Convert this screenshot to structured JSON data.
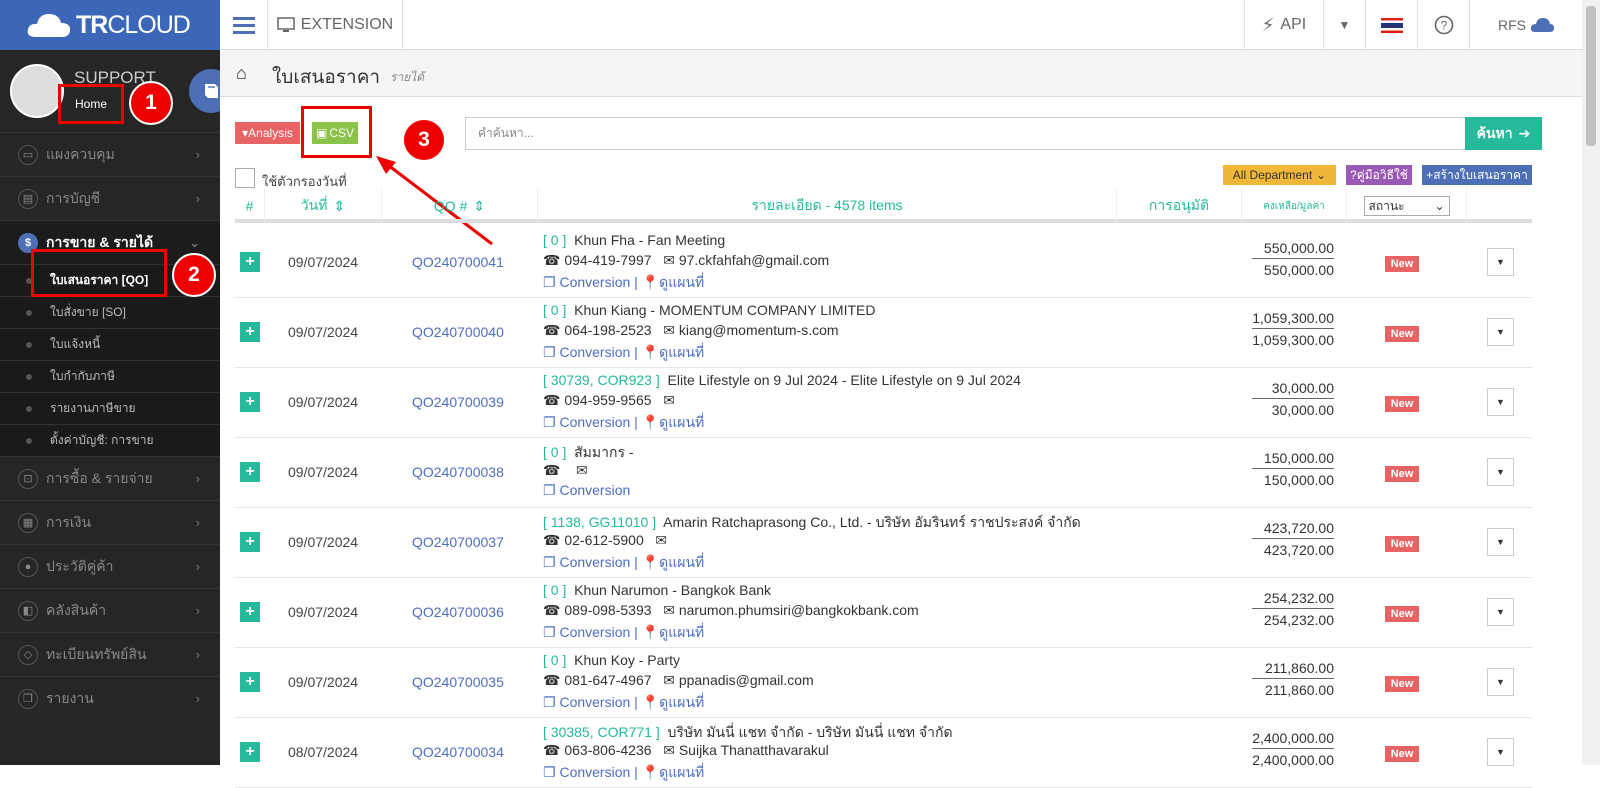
{
  "logo": {
    "bold": "TR",
    "rest": "CLOUD"
  },
  "topbar": {
    "extension": "EXTENSION",
    "api": "API",
    "user": "RFS"
  },
  "profile": {
    "name": "SUPPORT",
    "home": "Home",
    "sep": "| S"
  },
  "sidebar": {
    "items": [
      {
        "label": "แผงควบคุม",
        "icon": "monitor-icon"
      },
      {
        "label": "การบัญชี",
        "icon": "book-icon"
      },
      {
        "label": "การขาย & รายได้",
        "icon": "dollar-icon"
      },
      {
        "label": "การซื้อ & รายจ่าย",
        "icon": "cart-icon"
      },
      {
        "label": "การเงิน",
        "icon": "calendar-icon"
      },
      {
        "label": "ประวัติคู่ค้า",
        "icon": "users-icon"
      },
      {
        "label": "คลังสินค้า",
        "icon": "box-icon"
      },
      {
        "label": "ทะเบียนทรัพย์สิน",
        "icon": "diamond-icon"
      },
      {
        "label": "รายงาน",
        "icon": "copy-icon"
      }
    ],
    "subitems": [
      "ใบเสนอราคา [QO]",
      "ใบสั่งขาย [SO]",
      "ใบแจ้งหนี้",
      "ใบกำกับภาษี",
      "รายงานภาษีขาย",
      "ตั้งค่าบัญชี: การขาย"
    ]
  },
  "badges": [
    "1",
    "2",
    "3"
  ],
  "page": {
    "title": "ใบเสนอราคา",
    "subtitle": "รายได้"
  },
  "toolbar": {
    "analysis": "Analysis",
    "csv": "CSV",
    "search_placeholder": "คำค้นหา...",
    "search_btn": "ค้นหา",
    "date_filter": "ใช้ตัวกรองวันที่",
    "department": "All Department",
    "guide": "คู่มือวิธีใช้",
    "create": "สร้างใบเสนอราคา"
  },
  "table": {
    "headers": {
      "num": "#",
      "date": "วันที่",
      "qo": "QO #",
      "detail": "รายละเอียด - 4578 items",
      "approve": "การอนุมัติ",
      "balance": "คงเหลือ/มูลค่า",
      "status": "สถานะ"
    },
    "conv": "Conversion",
    "map": "ดูแผนที่",
    "rows": [
      {
        "date": "09/07/2024",
        "qo": "QO240700041",
        "cid": "[ 0 ]",
        "name": "Khun Fha - Fan Meeting",
        "phone": "094-419-7997",
        "email": "97.ckfahfah@gmail.com",
        "v1": "550,000.00",
        "v2": "550,000.00",
        "status": "New",
        "map": true
      },
      {
        "date": "09/07/2024",
        "qo": "QO240700040",
        "cid": "[ 0 ]",
        "name": "Khun Kiang - MOMENTUM COMPANY LIMITED",
        "phone": "064-198-2523",
        "email": "kiang@momentum-s.com",
        "v1": "1,059,300.00",
        "v2": "1,059,300.00",
        "status": "New",
        "map": true
      },
      {
        "date": "09/07/2024",
        "qo": "QO240700039",
        "cid": "[ 30739, COR923 ]",
        "name": "Elite Lifestyle on 9 Jul 2024 - Elite Lifestyle on 9 Jul 2024",
        "phone": "094-959-9565",
        "email": "",
        "v1": "30,000.00",
        "v2": "30,000.00",
        "status": "New",
        "map": true
      },
      {
        "date": "09/07/2024",
        "qo": "QO240700038",
        "cid": "[ 0 ]",
        "name": "สัมมากร -",
        "phone": "",
        "email": "",
        "v1": "150,000.00",
        "v2": "150,000.00",
        "status": "New",
        "map": false
      },
      {
        "date": "09/07/2024",
        "qo": "QO240700037",
        "cid": "[ 1138, GG11010 ]",
        "name": "Amarin Ratchaprasong Co., Ltd. - บริษัท อัมรินทร์ ราชประสงค์ จำกัด",
        "phone": "02-612-5900",
        "email": "",
        "v1": "423,720.00",
        "v2": "423,720.00",
        "status": "New",
        "map": true
      },
      {
        "date": "09/07/2024",
        "qo": "QO240700036",
        "cid": "[ 0 ]",
        "name": "Khun Narumon - Bangkok Bank",
        "phone": "089-098-5393",
        "email": "narumon.phumsiri@bangkokbank.com",
        "v1": "254,232.00",
        "v2": "254,232.00",
        "status": "New",
        "map": true
      },
      {
        "date": "09/07/2024",
        "qo": "QO240700035",
        "cid": "[ 0 ]",
        "name": "Khun Koy - Party",
        "phone": "081-647-4967",
        "email": "ppanadis@gmail.com",
        "v1": "211,860.00",
        "v2": "211,860.00",
        "status": "New",
        "map": true
      },
      {
        "date": "08/07/2024",
        "qo": "QO240700034",
        "cid": "[ 30385, COR771 ]",
        "name": "บริษัท มันนี่ แชท จำกัด - บริษัท มันนี่ แชท จำกัด",
        "phone": "063-806-4236",
        "email": "Suijka Thanatthavarakul",
        "v1": "2,400,000.00",
        "v2": "2,400,000.00",
        "status": "New",
        "map": true
      }
    ]
  }
}
